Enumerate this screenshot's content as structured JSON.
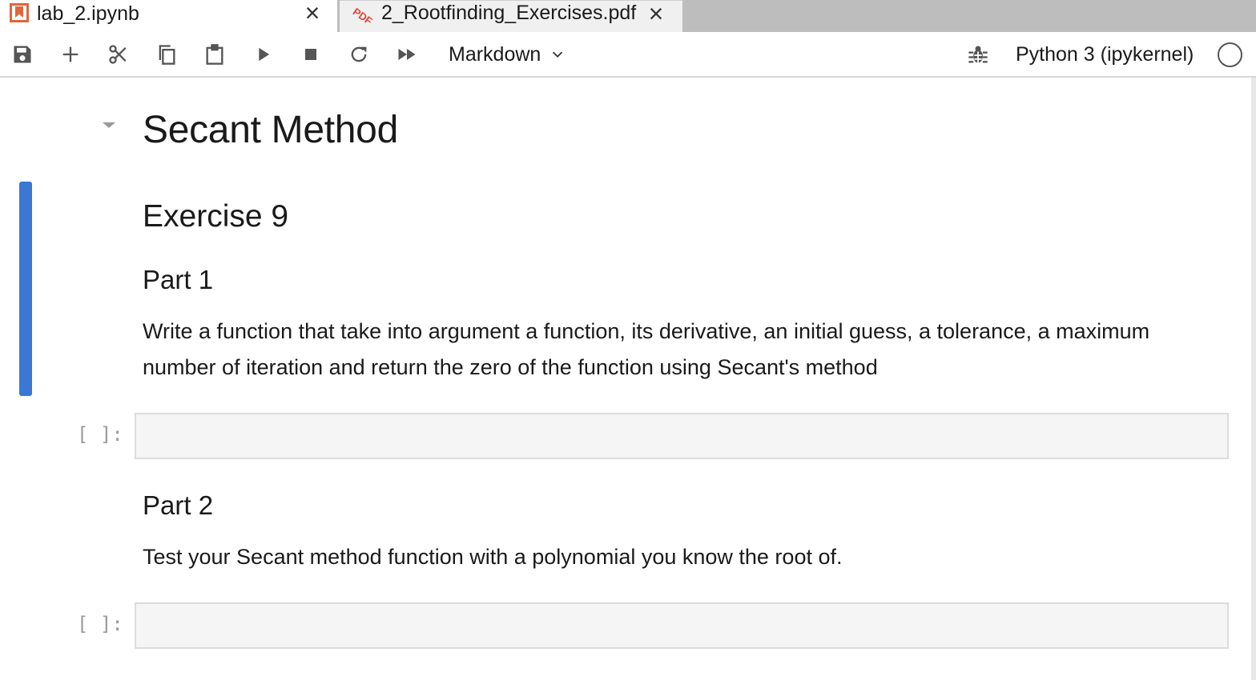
{
  "tabs": [
    {
      "label": "lab_2.ipynb",
      "icon": "notebook-icon",
      "active": true
    },
    {
      "label": "2_Rootfinding_Exercises.pdf",
      "icon": "pdf-icon",
      "active": false
    }
  ],
  "tab_icons": {
    "pdf": "PDF"
  },
  "toolbar": {
    "cell_type": "Markdown",
    "kernel_name": "Python 3 (ipykernel)"
  },
  "notebook": {
    "title": "Secant Method",
    "exercise_heading": "Exercise 9",
    "part1_heading": "Part 1",
    "part1_text": "Write a function that take into argument a function, its derivative, an initial guess, a tolerance, a maximum number of iteration and return the zero of the function using Secant's method",
    "part2_heading": "Part 2",
    "part2_text": "Test your Secant method function with a polynomial you know the root of.",
    "prompt_label": "[ ]:"
  },
  "colors": {
    "active_cell_bar": "#3a78d4",
    "notebook_icon": "#e0663a",
    "pdf_icon": "#e0473a"
  }
}
